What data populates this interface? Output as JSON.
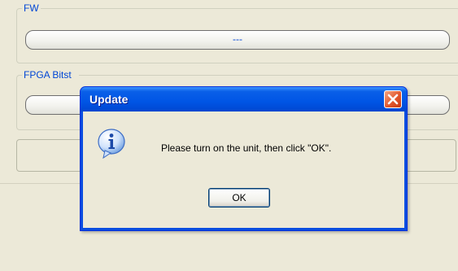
{
  "groups": {
    "fw": {
      "label": "FW",
      "value": "---"
    },
    "fpga": {
      "label": "FPGA Bitst",
      "value": ""
    }
  },
  "dialog": {
    "title": "Update",
    "message": "Please turn on the unit, then click \"OK\".",
    "ok_label": "OK",
    "icon": "info-icon",
    "close_icon": "close-icon"
  },
  "colors": {
    "window_bg": "#ece9d8",
    "titlebar_blue": "#0055e5",
    "group_label_blue": "#0046d5",
    "close_red": "#e2572c"
  }
}
